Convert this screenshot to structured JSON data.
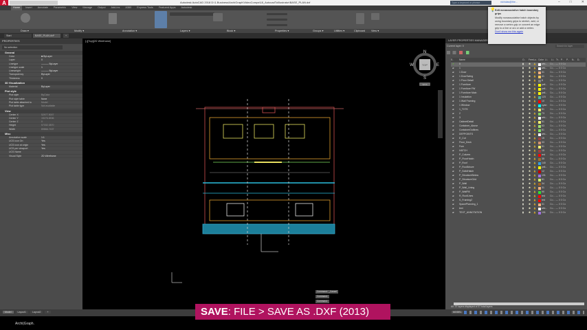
{
  "app": {
    "logo": "A",
    "title": "Autodesk AutoCAD 2018   D:\\1.Business\\ArchiGraph\\VideoComps\\18_AutocadToIllustrator\\BASE_PLAN.dxf",
    "search_placeholder": "Type a keyword or phrase",
    "user": "nicholas@the..."
  },
  "ribbon": {
    "tabs": [
      "Home",
      "Insert",
      "Annotate",
      "Parametric",
      "View",
      "Manage",
      "Output",
      "Add-ins",
      "A360",
      "Express Tools",
      "Featured Apps",
      "Autodesk"
    ],
    "active_tab": "Home",
    "panels": [
      "Draw ▾",
      "Modify ▾",
      "Annotation ▾",
      "Layers ▾",
      "Block ▾",
      "Properties ▾",
      "Groups ▾",
      "Utilities ▾",
      "Clipboard",
      "View ▾"
    ]
  },
  "tooltip": {
    "title": "Edit nonassociative hatch boundary grips",
    "body": "Modify nonassociative hatch objects by using boundary grips to stretch, add, or remove a vertex grip or convert an edge grip to a line or arc or add a vertex.",
    "link": "Don't show me this again"
  },
  "doc_tabs": [
    "Start",
    "BASE_PLAN.dxf*",
    "+"
  ],
  "properties": {
    "title": "PROPERTIES",
    "selection": "No selection",
    "sections": [
      {
        "name": "General",
        "rows": [
          [
            "Color",
            "■ ByLayer"
          ],
          [
            "Layer",
            "0"
          ],
          [
            "Linetype",
            "——— ByLayer"
          ],
          [
            "Linetype scale",
            "1"
          ],
          [
            "Lineweight",
            "——— ByLayer"
          ],
          [
            "Transparency",
            "ByLayer"
          ],
          [
            "Thickness",
            "0"
          ]
        ]
      },
      {
        "name": "3D Visualization",
        "rows": [
          [
            "Material",
            "ByLayer"
          ]
        ]
      },
      {
        "name": "Plot style",
        "rows": [
          [
            "Plot style",
            "ByColor"
          ],
          [
            "Plot style table",
            "None"
          ],
          [
            "Plot table attached to",
            "Model"
          ],
          [
            "Plot table type",
            "Not available"
          ]
        ]
      },
      {
        "name": "View",
        "rows": [
          [
            "Center X",
            "52977.5007"
          ],
          [
            "Center Y",
            "15276.6536"
          ],
          [
            "Center Z",
            "0"
          ],
          [
            "Height",
            "57332.3870"
          ],
          [
            "Width",
            "89866.7437"
          ]
        ]
      },
      {
        "name": "Misc",
        "rows": [
          [
            "Annotation scale",
            "1:1"
          ],
          [
            "UCS icon On",
            "Yes"
          ],
          [
            "UCS icon at origin",
            "Yes"
          ],
          [
            "UCS per viewport",
            "Yes"
          ],
          [
            "UCS Name",
            ""
          ],
          [
            "Visual Style",
            "2D Wireframe"
          ]
        ]
      }
    ]
  },
  "viewport": {
    "label": "[-][Top][2D Wireframe]",
    "compass": {
      "n": "N",
      "s": "S",
      "e": "E",
      "w": "W",
      "top": "TOP",
      "wcs": "WCS"
    },
    "commands": [
      "Command: '_Cancel'",
      "Command:",
      "Command:"
    ]
  },
  "layer_manager": {
    "title": "LAYER PROPERTIES MANAGER",
    "current": "Current layer: 0",
    "search": "Search for layer",
    "columns": [
      "S..",
      "Name",
      "O..",
      "Free..",
      "Lo..",
      "Color",
      "Li..",
      "Li..",
      "Tr..",
      "P..",
      "P..",
      "N..",
      "D.."
    ],
    "layers": [
      [
        "0",
        "whi...",
        "#ffffff"
      ],
      [
        "1",
        "whi...",
        "#ffffff"
      ],
      [
        "1 Door",
        "31",
        "#f0b080"
      ],
      [
        "1 DoorSwing",
        "41",
        "#f0c860"
      ],
      [
        "1 Floor Detail",
        "8",
        "#808080"
      ],
      [
        "1 Furniture",
        "yell...",
        "#ffff00"
      ],
      [
        "1 Furniture FW",
        "yell...",
        "#ffff00"
      ],
      [
        "1 Furniture Main",
        "yell...",
        "#ffff00"
      ],
      [
        "1 Insulation",
        "123",
        "#4fb0a0"
      ],
      [
        "1 Wall Framing",
        "10",
        "#ff0000"
      ],
      [
        "1 Window",
        "cyan",
        "#00ffff"
      ],
      [
        "1_TXTK",
        "51",
        "#f0f070"
      ],
      [
        "2",
        "73",
        "#80d060"
      ],
      [
        "3",
        "whi...",
        "#ffffff"
      ],
      [
        "CabinetDetail",
        "51",
        "#f0f070"
      ],
      [
        "Container_Above",
        "63",
        "#a0e070"
      ],
      [
        "ContainerOutlines",
        "81",
        "#80e060"
      ],
      [
        "DEFPOINTS",
        "whi...",
        "#ffffff"
      ],
      [
        "E_Cut",
        "15",
        "#a04040"
      ],
      [
        "Floor_Deck",
        "33",
        "#d09070"
      ],
      [
        "Furn",
        "51",
        "#f0f070"
      ],
      [
        "HATCH",
        "15",
        "#a04040"
      ],
      [
        "P_Column",
        "red",
        "#ff0000"
      ],
      [
        "P_FloorHatch",
        "35",
        "#a07030"
      ],
      [
        "P_Roof",
        "140",
        "#30a0e0"
      ],
      [
        "P_RoofAbove",
        "yell...",
        "#ffff00"
      ],
      [
        "P_SolidHatch",
        "12",
        "#c00000"
      ],
      [
        "P_StructureBelow",
        "191",
        "#a070e0"
      ],
      [
        "P_StructureGrid",
        "61",
        "#d0f070"
      ],
      [
        "P_Wall",
        "34",
        "#a06020"
      ],
      [
        "P_Wall_Lining",
        "31",
        "#f0b080"
      ],
      [
        "P_WallFill",
        "90",
        "#30e030"
      ],
      [
        "R_RoofLines",
        "red",
        "#ff0000"
      ],
      [
        "S_Framing2",
        "red",
        "#ff0000"
      ],
      [
        "SpacePlanning_1",
        "31",
        "#f0b080"
      ],
      [
        "text",
        "whi...",
        "#ffffff"
      ],
      [
        "TEXT_ANNOTATION",
        "191",
        "#a070e0"
      ]
    ],
    "rest": "Co... — 0  0    Co",
    "footer": "All: 37 layers displayed of 37 total layers"
  },
  "layout_tabs": [
    "Model",
    "Layout1",
    "Layout2",
    "+"
  ],
  "status": {
    "model": "MODEL",
    "scale": "1:1"
  },
  "caption": {
    "bold": "SAVE",
    "rest": ": FILE > SAVE AS .DXF (2013)"
  },
  "watermark": "Archi|Graph."
}
